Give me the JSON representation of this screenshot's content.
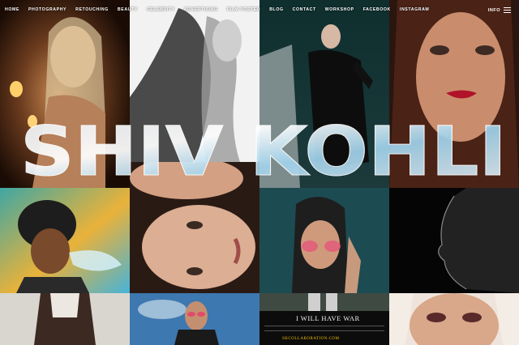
{
  "nav": {
    "items": [
      "HOME",
      "PHOTOGRAPHY",
      "RETOUCHING",
      "BEAUTY",
      "CELEBRITY",
      "ADVERTISING",
      "FILM POSTER",
      "BLOG",
      "CONTACT",
      "WORKSHOP",
      "FACEBOOK",
      "INSTAGRAM"
    ]
  },
  "info_label": "INFO",
  "hero_title": "SHIV KOHLI",
  "poster": {
    "title": "I WILL HAVE WAR",
    "link": "SKCOLLABORATION.COM"
  },
  "colors": {
    "background": "#000000",
    "nav_text": "#ffffff",
    "title_fill": "#e8eef2",
    "title_accent": "#6fb6d8",
    "poster_link": "#f2c200"
  }
}
